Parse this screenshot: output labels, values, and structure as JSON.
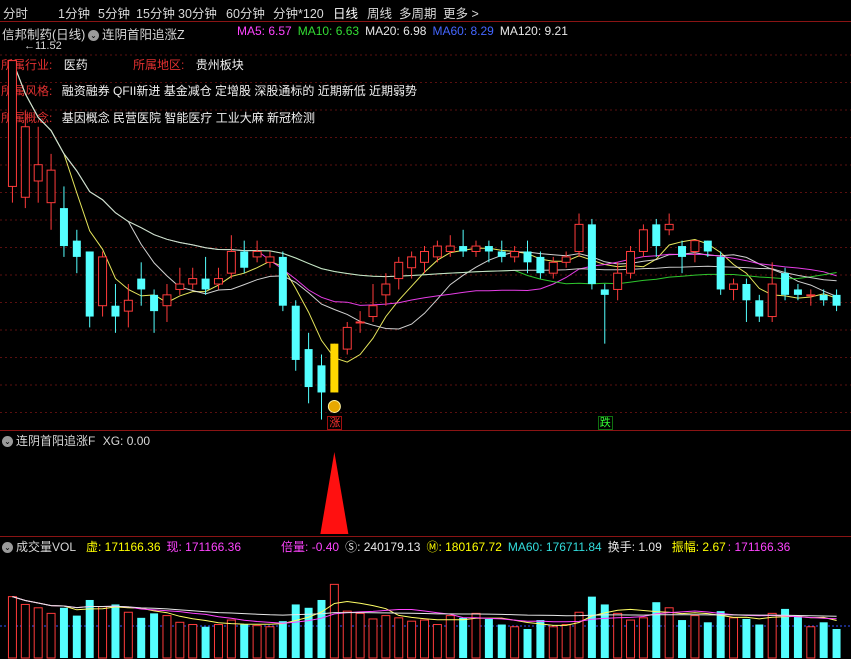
{
  "toolbar": {
    "periods": [
      "分时",
      "1分钟",
      "5分钟",
      "15分钟",
      "30分钟",
      "60分钟",
      "分钟*120",
      "日线",
      "周线",
      "多周期",
      "更多"
    ],
    "active": "日线"
  },
  "header": {
    "stock_title": "信邦制药(日线)",
    "indicator_name": "连阴首阳追涨Z",
    "ma_legend": [
      {
        "label": "MA5: 6.57",
        "color": "#ff44ff"
      },
      {
        "label": "MA10: 6.63",
        "color": "#33dd33"
      },
      {
        "label": "MA20: 6.98",
        "color": "#e8e8e8"
      },
      {
        "label": "MA60: 8.29",
        "color": "#4466ff"
      },
      {
        "label": "MA120: 9.21",
        "color": "#e8e8e8"
      }
    ]
  },
  "info": {
    "price_mark": "11.52",
    "industry_label": "所属行业:",
    "industry_value": "医药",
    "region_label": "所属地区:",
    "region_value": "贵州板块",
    "style_label": "所属风格:",
    "style_value": "融资融券 QFII新进 基金减仓 定增股 深股通标的 近期新低 近期弱势",
    "concept_label": "所属概念:",
    "concept_value": "基因概念 民营医院 智能医疗 工业大麻 新冠检测"
  },
  "signals": {
    "up": "涨",
    "down": "跌"
  },
  "panel2": {
    "title": "连阴首阳追涨F",
    "xg": "XG: 0.00"
  },
  "panel3": {
    "title": "成交量VOL",
    "items": [
      {
        "label": "虚: 171166.36",
        "color": "#ffff00"
      },
      {
        "label": "现: 171166.36",
        "color": "#ff44ff"
      },
      {
        "label": "倍量: -0.40",
        "color": "#ff44ff"
      },
      {
        "label": "Ⓢ: 240179.13",
        "color": "#e8e8e8"
      },
      {
        "label": "Ⓜ: 180167.72",
        "color": "#ffff00"
      },
      {
        "label": "MA60: 176711.84",
        "color": "#33dddd"
      },
      {
        "label": "换手: 1.09",
        "color": "#e8e8e8"
      },
      {
        "label": "振幅: 2.67",
        "color": "#ffff00"
      },
      {
        "label": ": 171166.36",
        "color": "#ff44ff"
      }
    ]
  },
  "chart_data": {
    "type": "candlestick",
    "ylim": [
      4.8,
      11.9
    ],
    "candles": [
      [
        9.2,
        11.52,
        11.52,
        8.9
      ],
      [
        9.0,
        10.3,
        10.6,
        8.8
      ],
      [
        9.3,
        9.6,
        10.3,
        8.9
      ],
      [
        8.9,
        9.5,
        9.8,
        8.4
      ],
      [
        8.8,
        8.1,
        9.2,
        7.9
      ],
      [
        8.2,
        7.9,
        8.4,
        7.6
      ],
      [
        8.0,
        6.8,
        8.0,
        6.6
      ],
      [
        7.0,
        7.9,
        8.0,
        6.8
      ],
      [
        7.0,
        6.8,
        7.4,
        6.5
      ],
      [
        6.9,
        7.1,
        7.4,
        6.6
      ],
      [
        7.5,
        7.3,
        7.8,
        7.0
      ],
      [
        7.2,
        6.9,
        7.3,
        6.5
      ],
      [
        7.0,
        7.2,
        7.4,
        6.7
      ],
      [
        7.3,
        7.4,
        7.7,
        7.2
      ],
      [
        7.4,
        7.5,
        7.7,
        7.3
      ],
      [
        7.5,
        7.3,
        7.9,
        7.2
      ],
      [
        7.4,
        7.5,
        7.7,
        7.3
      ],
      [
        7.6,
        8.0,
        8.3,
        7.5
      ],
      [
        8.0,
        7.7,
        8.2,
        7.6
      ],
      [
        7.9,
        8.0,
        8.2,
        7.8
      ],
      [
        7.8,
        7.9,
        8.0,
        7.7
      ],
      [
        7.9,
        7.0,
        8.0,
        6.9
      ],
      [
        7.0,
        6.0,
        7.1,
        5.8
      ],
      [
        6.2,
        5.5,
        6.5,
        5.2
      ],
      [
        5.9,
        5.4,
        6.1,
        4.9
      ],
      [
        5.4,
        6.3,
        6.3,
        5.4
      ],
      [
        6.2,
        6.6,
        6.7,
        6.1
      ],
      [
        6.7,
        6.7,
        6.9,
        6.5
      ],
      [
        6.8,
        7.0,
        7.4,
        6.7
      ],
      [
        7.2,
        7.4,
        7.6,
        7.0
      ],
      [
        7.5,
        7.8,
        7.9,
        7.3
      ],
      [
        7.7,
        7.9,
        8.0,
        7.5
      ],
      [
        7.8,
        8.0,
        8.1,
        7.6
      ],
      [
        7.9,
        8.1,
        8.2,
        7.8
      ],
      [
        8.0,
        8.1,
        8.3,
        7.9
      ],
      [
        8.1,
        8.0,
        8.4,
        7.9
      ],
      [
        8.0,
        8.1,
        8.2,
        7.9
      ],
      [
        8.1,
        8.0,
        8.2,
        7.8
      ],
      [
        8.0,
        7.9,
        8.2,
        7.8
      ],
      [
        7.9,
        8.0,
        8.1,
        7.8
      ],
      [
        8.0,
        7.8,
        8.2,
        7.6
      ],
      [
        7.9,
        7.6,
        8.0,
        7.5
      ],
      [
        7.6,
        7.8,
        7.9,
        7.5
      ],
      [
        7.8,
        7.9,
        8.0,
        7.7
      ],
      [
        8.0,
        8.5,
        8.7,
        7.9
      ],
      [
        8.5,
        7.4,
        8.6,
        7.3
      ],
      [
        7.3,
        7.2,
        7.4,
        6.3
      ],
      [
        7.3,
        7.6,
        7.8,
        7.1
      ],
      [
        7.6,
        8.0,
        8.1,
        7.5
      ],
      [
        8.0,
        8.4,
        8.5,
        7.9
      ],
      [
        8.5,
        8.1,
        8.6,
        7.9
      ],
      [
        8.4,
        8.5,
        8.7,
        8.3
      ],
      [
        8.1,
        7.9,
        8.2,
        7.6
      ],
      [
        8.0,
        8.2,
        8.2,
        7.8
      ],
      [
        8.2,
        8.0,
        8.2,
        7.9
      ],
      [
        7.9,
        7.3,
        8.0,
        7.2
      ],
      [
        7.3,
        7.4,
        7.5,
        7.1
      ],
      [
        7.4,
        7.1,
        7.5,
        6.7
      ],
      [
        7.1,
        6.8,
        7.2,
        6.7
      ],
      [
        6.8,
        7.4,
        7.8,
        6.7
      ],
      [
        7.6,
        7.2,
        7.7,
        7.1
      ],
      [
        7.3,
        7.2,
        7.4,
        7.1
      ],
      [
        7.2,
        7.2,
        7.3,
        7.0
      ],
      [
        7.2,
        7.1,
        7.3,
        7.0
      ],
      [
        7.2,
        7.0,
        7.3,
        6.9
      ]
    ],
    "volume_ylim": [
      0,
      95
    ],
    "volumes": [
      55,
      48,
      45,
      40,
      45,
      38,
      52,
      46,
      48,
      41,
      36,
      40,
      38,
      32,
      30,
      28,
      30,
      34,
      30,
      29,
      28,
      33,
      48,
      45,
      52,
      66,
      42,
      40,
      35,
      38,
      36,
      33,
      34,
      30,
      38,
      36,
      40,
      35,
      30,
      28,
      26,
      34,
      28,
      30,
      41,
      55,
      48,
      40,
      34,
      36,
      50,
      45,
      34,
      38,
      32,
      42,
      36,
      35,
      30,
      40,
      44,
      38,
      28,
      32,
      26
    ],
    "signal_up_index": 25,
    "signal_down_index": 46
  }
}
